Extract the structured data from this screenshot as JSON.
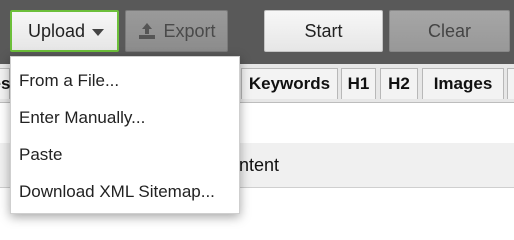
{
  "toolbar": {
    "upload_label": "Upload",
    "export_label": "Export",
    "start_label": "Start",
    "clear_label": "Clear",
    "upload_icon": "chevron-down-icon",
    "export_icon": "upload-tray-icon"
  },
  "tabs": [
    {
      "label": "es"
    },
    {
      "label": "Keywords"
    },
    {
      "label": "H1"
    },
    {
      "label": "H2"
    },
    {
      "label": "Images"
    }
  ],
  "table": {
    "column_partial": "ntent"
  },
  "upload_menu": {
    "items": [
      {
        "label": "From a File..."
      },
      {
        "label": "Enter Manually..."
      },
      {
        "label": "Paste"
      },
      {
        "label": "Download XML Sitemap..."
      }
    ]
  },
  "colors": {
    "toolbar_bg": "#595959",
    "accent_border": "#6cbf3a"
  }
}
